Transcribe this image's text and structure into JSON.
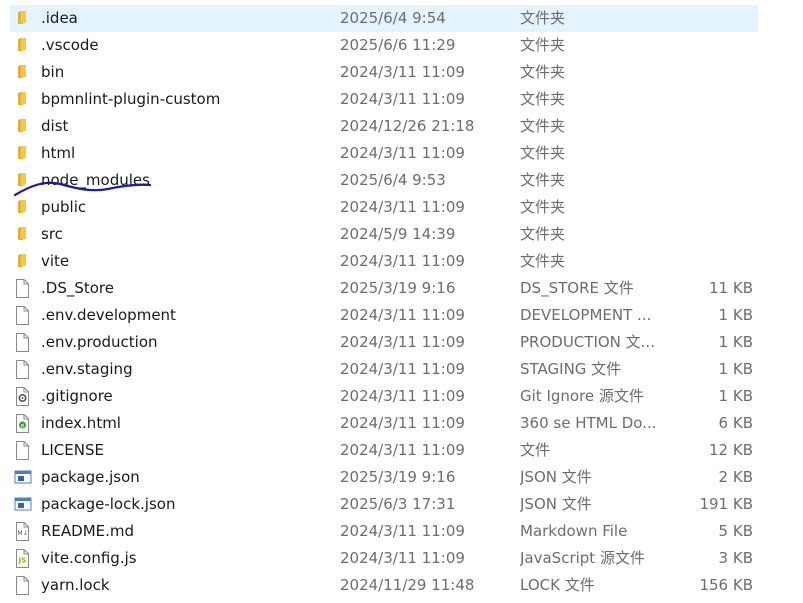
{
  "colors": {
    "folder": "#f3c94c",
    "selection": "#e5f3ff",
    "secondary_text": "#6d6d6d",
    "annotation_ink": "#1a1aa8"
  },
  "files": [
    {
      "name": ".idea",
      "date": "2025/6/4 9:54",
      "type": "文件夹",
      "size": "",
      "icon": "folder-icon",
      "selected": true
    },
    {
      "name": ".vscode",
      "date": "2025/6/6 11:29",
      "type": "文件夹",
      "size": "",
      "icon": "folder-icon"
    },
    {
      "name": "bin",
      "date": "2024/3/11 11:09",
      "type": "文件夹",
      "size": "",
      "icon": "folder-icon"
    },
    {
      "name": "bpmnlint-plugin-custom",
      "date": "2024/3/11 11:09",
      "type": "文件夹",
      "size": "",
      "icon": "folder-icon"
    },
    {
      "name": "dist",
      "date": "2024/12/26 21:18",
      "type": "文件夹",
      "size": "",
      "icon": "folder-icon"
    },
    {
      "name": "html",
      "date": "2024/3/11 11:09",
      "type": "文件夹",
      "size": "",
      "icon": "folder-icon"
    },
    {
      "name": "node_modules",
      "date": "2025/6/4 9:53",
      "type": "文件夹",
      "size": "",
      "icon": "folder-icon",
      "annotated": true
    },
    {
      "name": "public",
      "date": "2024/3/11 11:09",
      "type": "文件夹",
      "size": "",
      "icon": "folder-icon"
    },
    {
      "name": "src",
      "date": "2024/5/9 14:39",
      "type": "文件夹",
      "size": "",
      "icon": "folder-icon"
    },
    {
      "name": "vite",
      "date": "2024/3/11 11:09",
      "type": "文件夹",
      "size": "",
      "icon": "folder-icon"
    },
    {
      "name": ".DS_Store",
      "date": "2025/3/19 9:16",
      "type": "DS_STORE 文件",
      "size": "11 KB",
      "icon": "blank-file-icon"
    },
    {
      "name": ".env.development",
      "date": "2024/3/11 11:09",
      "type": "DEVELOPMENT ...",
      "size": "1 KB",
      "icon": "blank-file-icon"
    },
    {
      "name": ".env.production",
      "date": "2024/3/11 11:09",
      "type": "PRODUCTION 文...",
      "size": "1 KB",
      "icon": "blank-file-icon"
    },
    {
      "name": ".env.staging",
      "date": "2024/3/11 11:09",
      "type": "STAGING 文件",
      "size": "1 KB",
      "icon": "blank-file-icon"
    },
    {
      "name": ".gitignore",
      "date": "2024/3/11 11:09",
      "type": "Git Ignore 源文件",
      "size": "1 KB",
      "icon": "gear-file-icon"
    },
    {
      "name": "index.html",
      "date": "2024/3/11 11:09",
      "type": "360 se HTML Do...",
      "size": "6 KB",
      "icon": "html-file-icon"
    },
    {
      "name": "LICENSE",
      "date": "2024/3/11 11:09",
      "type": "文件",
      "size": "12 KB",
      "icon": "blank-file-icon"
    },
    {
      "name": "package.json",
      "date": "2025/3/19 9:16",
      "type": "JSON 文件",
      "size": "2 KB",
      "icon": "json-file-icon"
    },
    {
      "name": "package-lock.json",
      "date": "2025/6/3 17:31",
      "type": "JSON 文件",
      "size": "191 KB",
      "icon": "json-file-icon"
    },
    {
      "name": "README.md",
      "date": "2024/3/11 11:09",
      "type": "Markdown File",
      "size": "5 KB",
      "icon": "markdown-file-icon"
    },
    {
      "name": "vite.config.js",
      "date": "2024/3/11 11:09",
      "type": "JavaScript 源文件",
      "size": "3 KB",
      "icon": "js-file-icon"
    },
    {
      "name": "yarn.lock",
      "date": "2024/11/29 11:48",
      "type": "LOCK 文件",
      "size": "156 KB",
      "icon": "blank-file-icon"
    }
  ]
}
